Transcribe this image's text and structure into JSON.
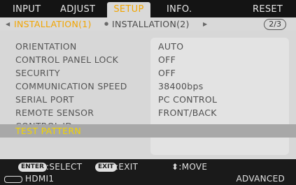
{
  "tabs": [
    {
      "label": "INPUT",
      "active": false
    },
    {
      "label": "ADJUST",
      "active": false
    },
    {
      "label": "SETUP",
      "active": true
    },
    {
      "label": "INFO.",
      "active": false
    },
    {
      "label": "RESET",
      "active": false
    }
  ],
  "subtabs": {
    "items": [
      {
        "label": "INSTALLATION(1)",
        "active": true
      },
      {
        "label": "INSTALLATION(2)",
        "active": false
      }
    ],
    "page_indicator": "2/3"
  },
  "menu": {
    "rows": [
      {
        "label": "ORIENTATION",
        "value": "AUTO"
      },
      {
        "label": "CONTROL PANEL LOCK",
        "value": "OFF"
      },
      {
        "label": "SECURITY",
        "value": "OFF"
      },
      {
        "label": "COMMUNICATION SPEED",
        "value": "38400bps"
      },
      {
        "label": "SERIAL PORT",
        "value": "PC CONTROL"
      },
      {
        "label": "REMOTE SENSOR",
        "value": "FRONT/BACK"
      },
      {
        "label": "CONTROL ID",
        "value": ""
      },
      {
        "label": "TEST PATTERN",
        "value": "",
        "selected": true
      }
    ]
  },
  "footer": {
    "enter_key": "ENTER",
    "enter_action": ":SELECT",
    "exit_key": "EXIT",
    "exit_action": ":EXIT",
    "move_action": "⬍:MOVE",
    "source": "HDMI1",
    "mode": "ADVANCED"
  },
  "colors": {
    "active_tab_text": "#f2a500",
    "selected_label": "#f2d400",
    "tab_bar": "#141414",
    "panel": "#d7d7d7"
  }
}
